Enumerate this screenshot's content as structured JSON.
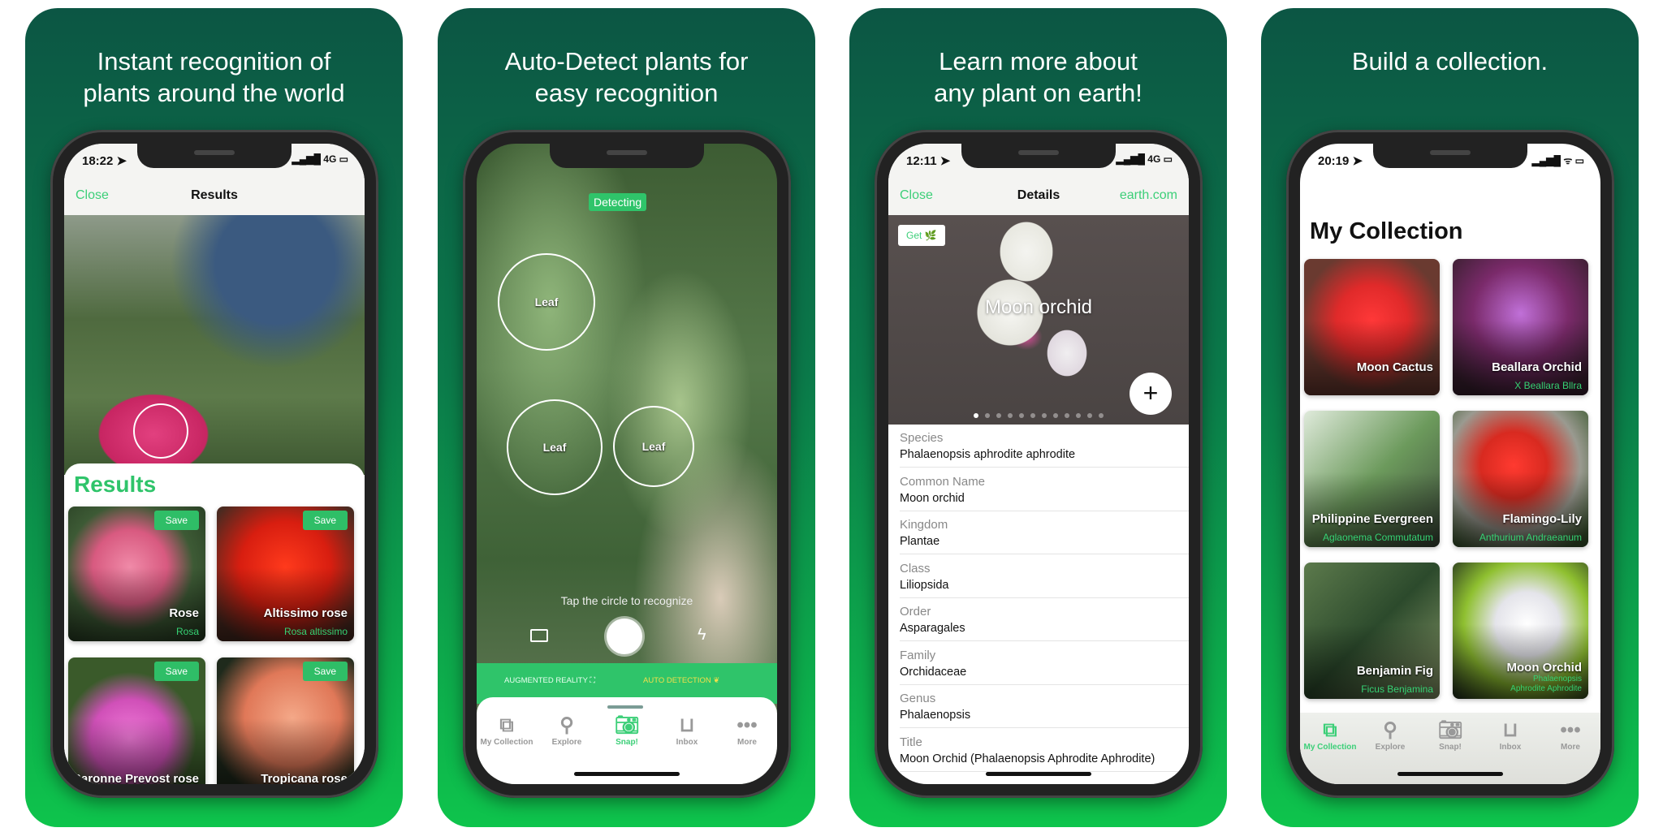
{
  "colors": {
    "accent": "#3ccf78",
    "panel_top": "#0c5644",
    "panel_bottom": "#0ec44c"
  },
  "panels": [
    {
      "headline": "Instant recognition of\nplants around the world"
    },
    {
      "headline": "Auto-Detect plants for\neasy recognition"
    },
    {
      "headline": "Learn more about\nany plant on earth!"
    },
    {
      "headline": "Build a collection."
    }
  ],
  "results": {
    "time": "18:22 ➤",
    "signal": "▂▄▆█ 4G ▭",
    "close": "Close",
    "title": "Results",
    "sheet_title": "Results",
    "cards": [
      {
        "name": "Rose",
        "sci": "Rosa",
        "save": "Save"
      },
      {
        "name": "Altissimo rose",
        "sci": "Rosa altissimo",
        "save": "Save"
      },
      {
        "name": "Baronne Prevost rose",
        "sci": "",
        "save": "Save"
      },
      {
        "name": "Tropicana rose",
        "sci": "",
        "save": "Save"
      }
    ]
  },
  "camera": {
    "badge": "Detecting",
    "leaves": [
      "Leaf",
      "Leaf",
      "Leaf"
    ],
    "hint": "Tap the circle to recognize",
    "mode_ar": "AUGMENTED REALITY",
    "mode_auto": "AUTO DETECTION",
    "active_tab": "Snap!"
  },
  "tabs": [
    {
      "label": "My Collection",
      "icon": "collection-icon",
      "glyph": "⧉"
    },
    {
      "label": "Explore",
      "icon": "search-icon",
      "glyph": "⚲"
    },
    {
      "label": "Snap!",
      "icon": "camera-icon",
      "glyph": "📷︎"
    },
    {
      "label": "Inbox",
      "icon": "inbox-icon",
      "glyph": "⊔"
    },
    {
      "label": "More",
      "icon": "more-icon",
      "glyph": "•••"
    }
  ],
  "details": {
    "time": "12:11 ➤",
    "signal": "▂▄▆█ 4G ▭",
    "close": "Close",
    "title": "Details",
    "link": "earth.com",
    "get": "Get 🌿",
    "plant_name": "Moon orchid",
    "image_count": 12,
    "image_index": 1,
    "rows": [
      {
        "label": "Species",
        "value": "Phalaenopsis aphrodite aphrodite"
      },
      {
        "label": "Common Name",
        "value": "Moon orchid"
      },
      {
        "label": "Kingdom",
        "value": "Plantae"
      },
      {
        "label": "Class",
        "value": "Liliopsida"
      },
      {
        "label": "Order",
        "value": "Asparagales"
      },
      {
        "label": "Family",
        "value": "Orchidaceae"
      },
      {
        "label": "Genus",
        "value": "Phalaenopsis"
      },
      {
        "label": "Title",
        "value": "Moon Orchid   (Phalaenopsis Aphrodite Aphrodite)"
      }
    ]
  },
  "collection": {
    "time": "20:19 ➤",
    "signal": "▂▄▆█ ᯤ ▭",
    "title": "My Collection",
    "active_tab": "My Collection",
    "items": [
      {
        "name": "Moon Cactus",
        "sci": ""
      },
      {
        "name": "Beallara Orchid",
        "sci": "X Beallara Bllra"
      },
      {
        "name": "Philippine Evergreen",
        "sci": "Aglaonema Commutatum"
      },
      {
        "name": "Flamingo-Lily",
        "sci": "Anthurium Andraeanum"
      },
      {
        "name": "Benjamin Fig",
        "sci": "Ficus Benjamina"
      },
      {
        "name": "Moon Orchid",
        "sci": "Phalaenopsis\nAphrodite Aphrodite"
      }
    ]
  }
}
